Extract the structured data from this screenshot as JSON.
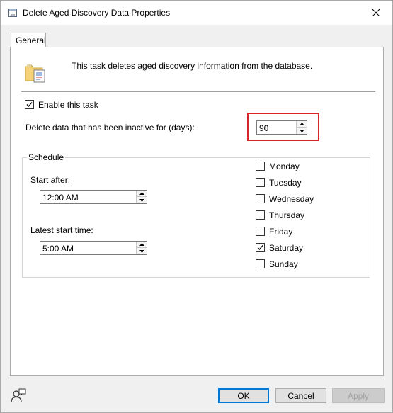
{
  "window": {
    "title": "Delete Aged Discovery Data Properties"
  },
  "tabs": [
    {
      "label": "General"
    }
  ],
  "header": {
    "description": "This task deletes aged discovery information from the database."
  },
  "task": {
    "enable_label": "Enable this task",
    "enable_checked": true,
    "inactive_label": "Delete data that has been inactive for (days):",
    "inactive_days": "90"
  },
  "schedule": {
    "title": "Schedule",
    "start_after_label": "Start after:",
    "start_after_value": "12:00 AM",
    "latest_start_label": "Latest start time:",
    "latest_start_value": "5:00 AM",
    "days": [
      {
        "label": "Monday",
        "checked": false
      },
      {
        "label": "Tuesday",
        "checked": false
      },
      {
        "label": "Wednesday",
        "checked": false
      },
      {
        "label": "Thursday",
        "checked": false
      },
      {
        "label": "Friday",
        "checked": false
      },
      {
        "label": "Saturday",
        "checked": true
      },
      {
        "label": "Sunday",
        "checked": false
      }
    ]
  },
  "buttons": {
    "ok": "OK",
    "cancel": "Cancel",
    "apply": "Apply"
  },
  "icons": {
    "title": "properties-icon",
    "close": "close-icon",
    "header": "folder-document-icon",
    "help": "help-user-icon"
  },
  "colors": {
    "highlight": "#d8232a",
    "default_button_border": "#0078d7"
  }
}
